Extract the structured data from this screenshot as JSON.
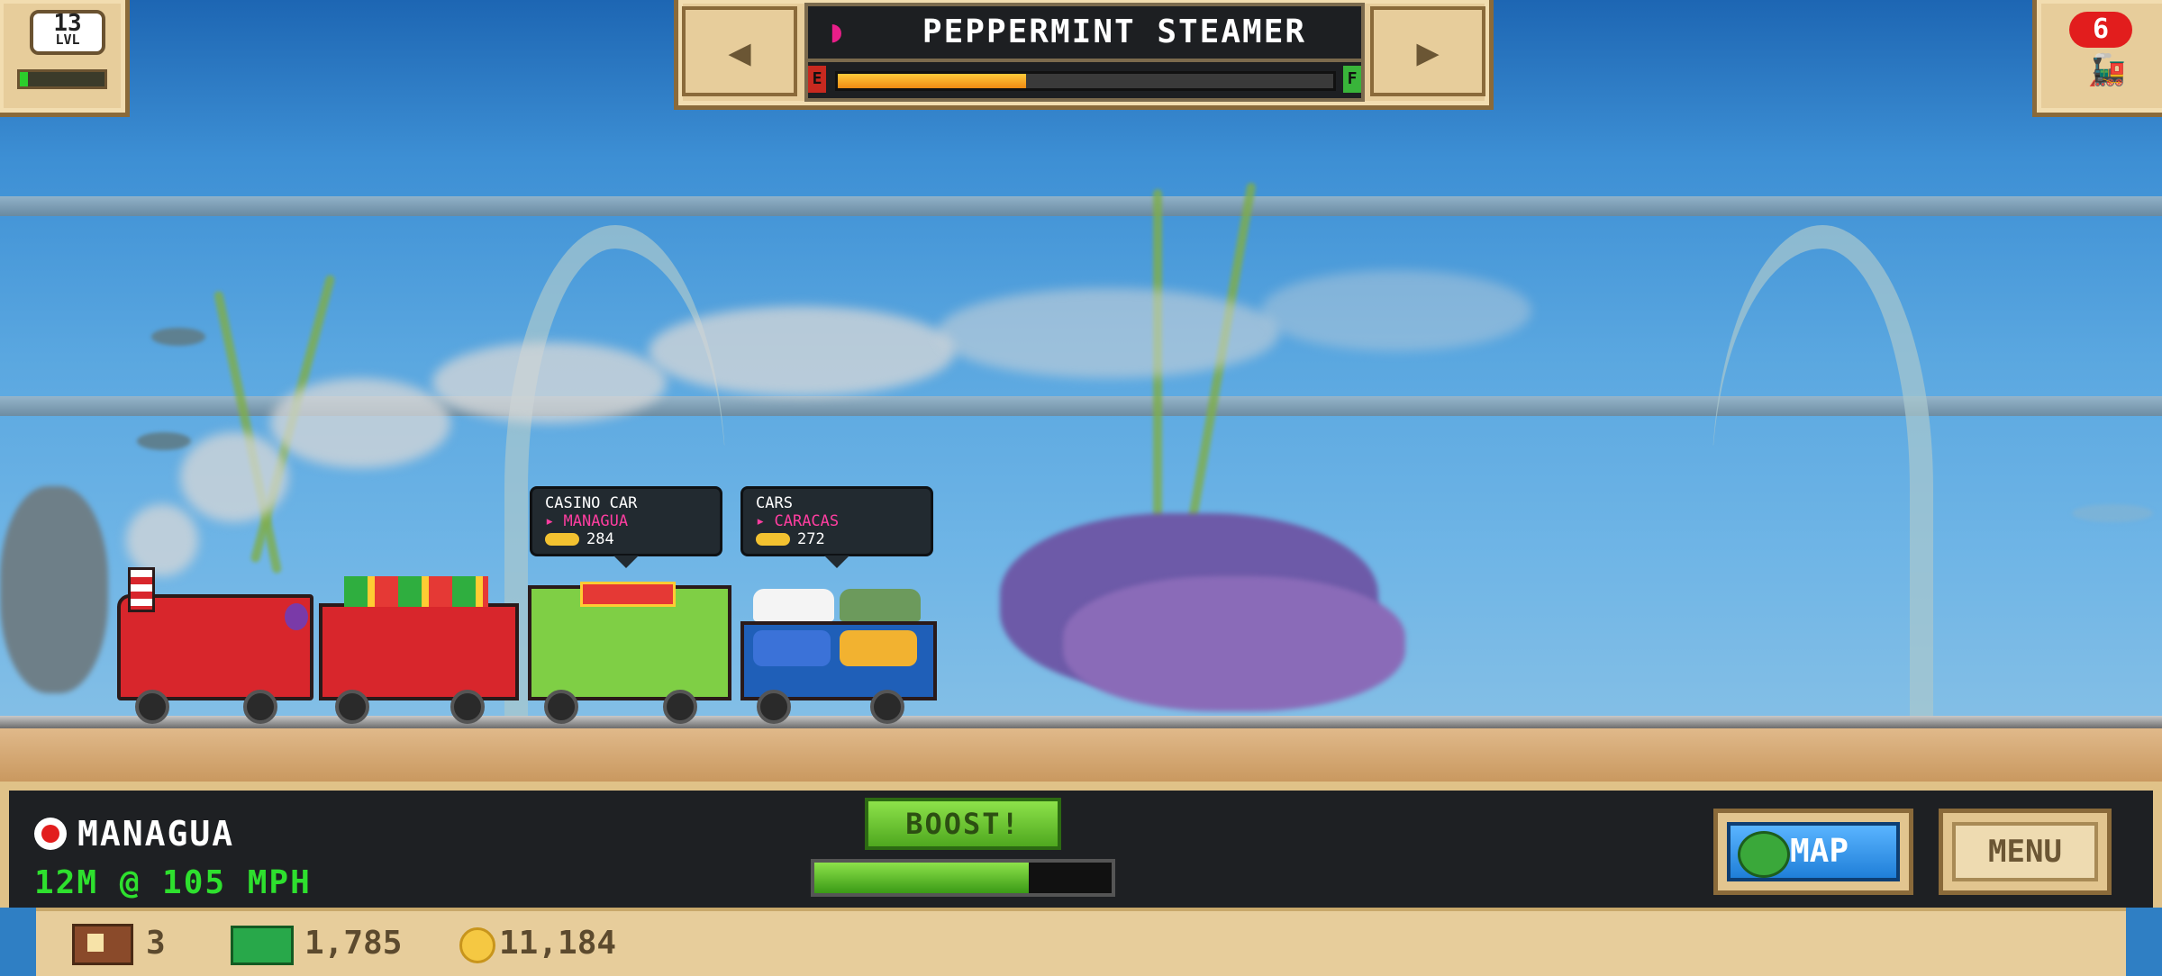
{
  "player": {
    "level": "13",
    "level_label": "LVL",
    "xp_progress": 0.1
  },
  "train": {
    "name": "PEPPERMINT STEAMER",
    "fuel_empty_label": "E",
    "fuel_full_label": "F",
    "fuel_level": 0.38,
    "prev_icon": "◀",
    "next_icon": "▶"
  },
  "trains_owned": {
    "count": "6"
  },
  "cars": [
    {
      "type": "CASINO CAR",
      "destination": "MANAGUA",
      "value": "284"
    },
    {
      "type": "CARS",
      "destination": "CARACAS",
      "value": "272"
    }
  ],
  "status": {
    "station": "MANAGUA",
    "speed_text": "12M @ 105 MPH"
  },
  "boost": {
    "label": "BOOST!",
    "level": 0.72
  },
  "buttons": {
    "map": "MAP",
    "menu": "MENU"
  },
  "resources": {
    "crates": "3",
    "cash": "1,785",
    "coins": "11,184"
  },
  "colors": {
    "accent_green": "#2ee02e",
    "destination_pink": "#ff3ea0",
    "train_red": "#d8262c"
  }
}
